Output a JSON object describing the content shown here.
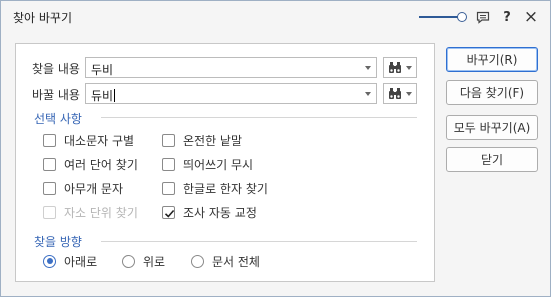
{
  "window": {
    "title": "찾아 바꾸기"
  },
  "titlebar": {
    "slider_level": 1.0,
    "icons": [
      "opacity-slider",
      "comment-icon",
      "help-icon",
      "close-icon"
    ],
    "help_label": "?",
    "close_label": "×"
  },
  "find": {
    "label": "찾을 내용",
    "value": "두비"
  },
  "replace": {
    "label": "바꿀 내용",
    "value": "듀비"
  },
  "options": {
    "title": "선택 사항",
    "items": [
      {
        "label": "대소문자 구별",
        "checked": false,
        "disabled": false
      },
      {
        "label": "온전한 낱말",
        "checked": false,
        "disabled": false
      },
      {
        "label": "여러 단어 찾기",
        "checked": false,
        "disabled": false
      },
      {
        "label": "띄어쓰기 무시",
        "checked": false,
        "disabled": false
      },
      {
        "label": "아무개 문자",
        "checked": false,
        "disabled": false
      },
      {
        "label": "한글로 한자 찾기",
        "checked": false,
        "disabled": false
      },
      {
        "label": "자소 단위 찾기",
        "checked": false,
        "disabled": true
      },
      {
        "label": "조사 자동 교정",
        "checked": true,
        "disabled": false
      }
    ]
  },
  "direction": {
    "title": "찾을 방향",
    "options": [
      {
        "label": "아래로",
        "selected": true
      },
      {
        "label": "위로",
        "selected": false
      },
      {
        "label": "문서 전체",
        "selected": false
      }
    ]
  },
  "buttons": {
    "replace": "바꾸기(R)",
    "find_next": "다음 찾기(F)",
    "replace_all": "모두 바꾸기(A)",
    "close": "닫기"
  },
  "colors": {
    "accent": "#3766b5",
    "radio_selected": "#3c6fc4",
    "button_focus": "#2f6fd1"
  }
}
